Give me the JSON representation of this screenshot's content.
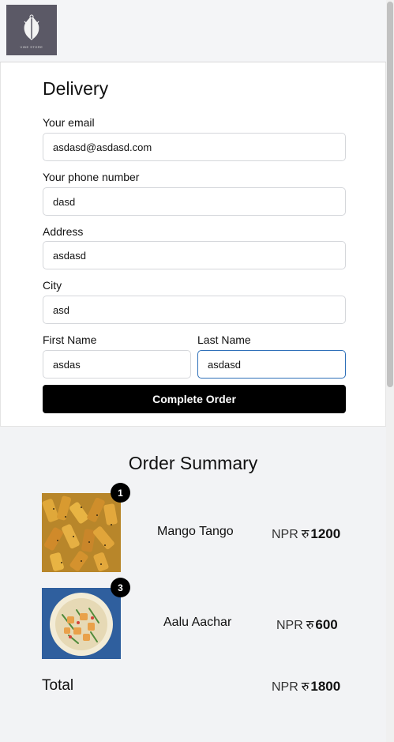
{
  "logo": {
    "icon": "leaf-logo-icon",
    "text": "VIBE STORE"
  },
  "delivery": {
    "title": "Delivery",
    "email_label": "Your email",
    "email_value": "asdasd@asdasd.com",
    "phone_label": "Your phone number",
    "phone_value": "dasd",
    "address_label": "Address",
    "address_value": "asdasd",
    "city_label": "City",
    "city_value": "asd",
    "first_name_label": "First Name",
    "first_name_value": "asdas",
    "last_name_label": "Last Name",
    "last_name_value": "asdasd",
    "submit_label": "Complete Order"
  },
  "summary": {
    "title": "Order Summary",
    "items": [
      {
        "name": "Mango Tango",
        "qty": "1",
        "currency": "NPR",
        "rupee": "रु",
        "amount": "1200",
        "image": "mango-pickle-photo"
      },
      {
        "name": "Aalu Aachar",
        "qty": "3",
        "currency": "NPR",
        "rupee": "रु",
        "amount": "600",
        "image": "potato-pickle-photo"
      }
    ],
    "total_label": "Total",
    "total_currency": "NPR",
    "total_rupee": "रु",
    "total_amount": "1800"
  },
  "colors": {
    "button": "#000000",
    "focus_border": "#2d6fb8",
    "page_bg": "#f2f3f5"
  }
}
